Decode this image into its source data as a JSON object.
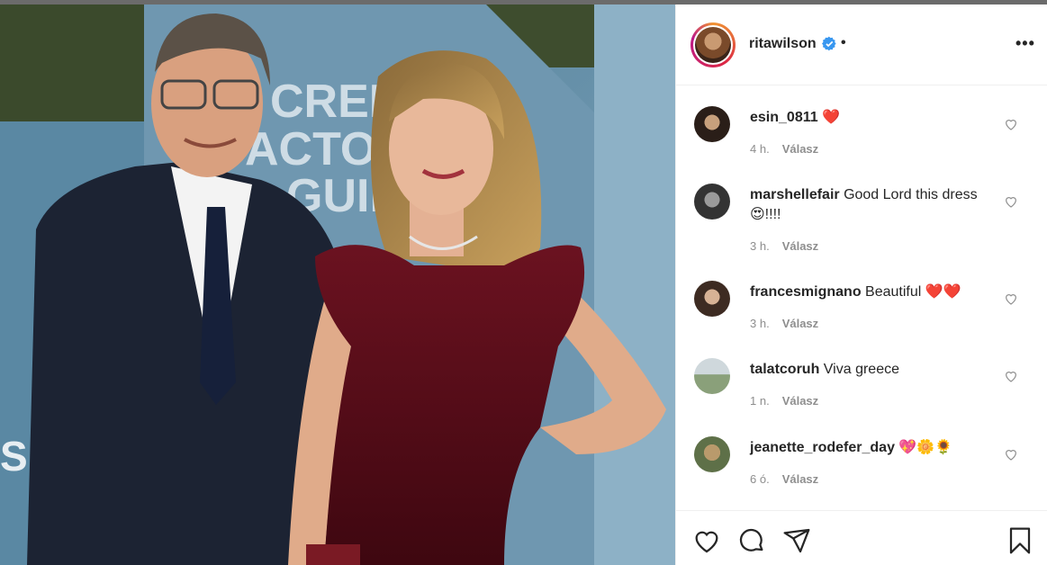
{
  "post": {
    "username": "ritawilson",
    "separator": "•"
  },
  "icons": {
    "verified": "verified-badge-icon",
    "more": "more-options-icon",
    "like": "heart-icon",
    "comment": "comment-icon",
    "share": "paper-plane-icon",
    "save": "bookmark-icon"
  },
  "colors": {
    "verified": "#3897f0",
    "heart_emoji": "#e0245e",
    "meta": "#8e8e8e"
  },
  "comments": [
    {
      "user": "esin_0811",
      "text": "❤️",
      "time": "4 h.",
      "reply": "Válasz"
    },
    {
      "user": "marshellefair",
      "text": "Good Lord this dress 😍!!!!",
      "time": "3 h.",
      "reply": "Válasz"
    },
    {
      "user": "francesmignano",
      "text": "Beautiful ❤️❤️",
      "time": "3 h.",
      "reply": "Válasz"
    },
    {
      "user": "talatcoruh",
      "text": "Viva greece",
      "time": "1 n.",
      "reply": "Válasz"
    },
    {
      "user": "jeanette_rodefer_day",
      "text": "💖🌼🌻",
      "time": "6 ó.",
      "reply": "Válasz"
    }
  ],
  "more_label": "•••"
}
